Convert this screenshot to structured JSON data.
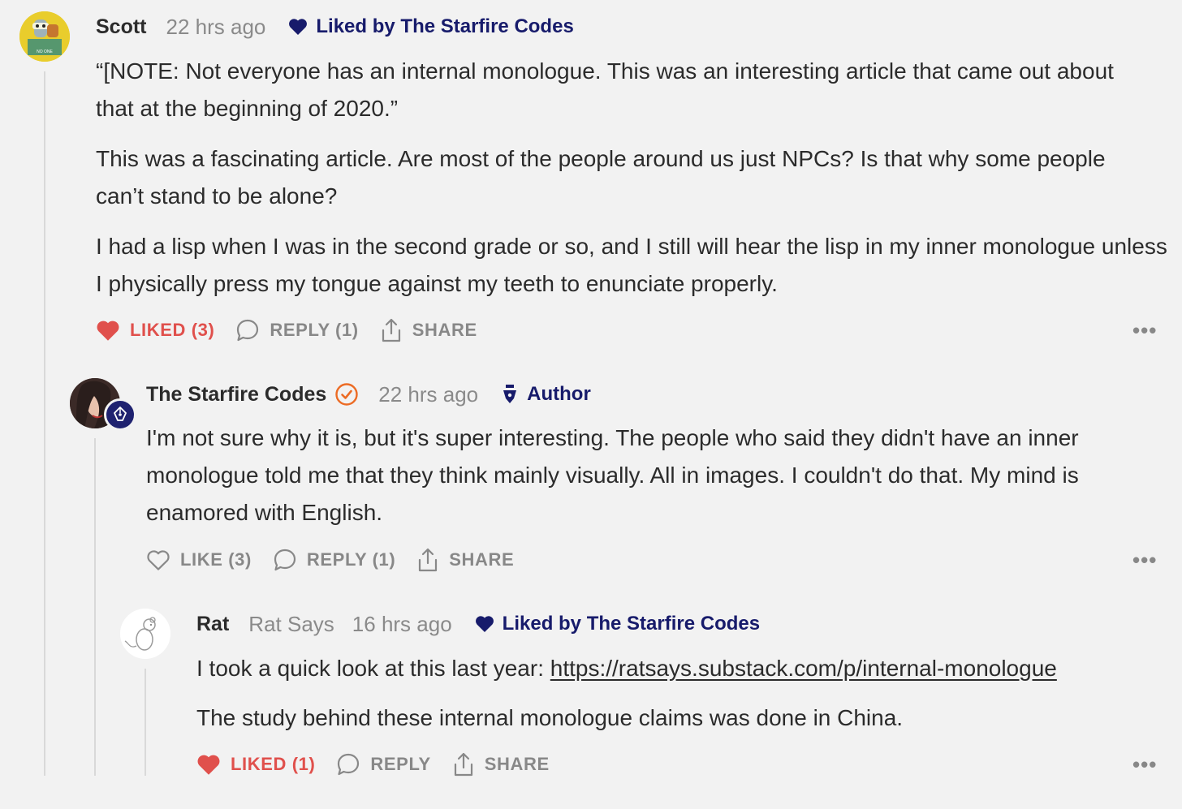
{
  "colors": {
    "background": "#f2f2f2",
    "text": "#2b2b2b",
    "muted": "#8a8a8a",
    "liked_red": "#e0504c",
    "navy": "#171b6b",
    "verified_orange": "#ec6b24"
  },
  "comments": [
    {
      "author": "Scott",
      "timestamp": "22 hrs ago",
      "badge_icon": "heart-icon",
      "badge_text": "Liked by The Starfire Codes",
      "paragraphs": [
        "“[NOTE: Not everyone has an internal monologue. This was an interesting article that came out about that at the beginning of 2020.”",
        "This was a fascinating article. Are most of the people around us just NPCs? Is that why some people can’t stand to be alone?",
        "I had a lisp when I was in the second grade or so, and I still will hear the lisp in my inner monologue unless I physically press my tongue against my teeth to enunciate properly."
      ],
      "actions": {
        "like": "LIKED (3)",
        "reply": "REPLY (1)",
        "share": "SHARE",
        "more": "•••"
      }
    },
    {
      "author": "The Starfire Codes",
      "timestamp": "22 hrs ago",
      "verified_icon": "verified-check-icon",
      "badge_icon": "pen-nib-icon",
      "badge_text": "Author",
      "paragraphs": [
        "I'm not sure why it is, but it's super interesting. The people who said they didn't have an inner monologue told me that they think mainly visually. All in images. I couldn't do that. My mind is enamored with English."
      ],
      "actions": {
        "like": "LIKE (3)",
        "reply": "REPLY (1)",
        "share": "SHARE",
        "more": "•••"
      }
    },
    {
      "author": "Rat",
      "handle": "Rat Says",
      "timestamp": "16 hrs ago",
      "badge_icon": "heart-icon",
      "badge_text": "Liked by The Starfire Codes",
      "paragraph1_prefix": "I took a quick look at this last year: ",
      "link": "https://ratsays.substack.com/p/internal-monologue",
      "paragraph2": "The study behind these internal monologue claims was done in China.",
      "actions": {
        "like": "LIKED (1)",
        "reply": "REPLY",
        "share": "SHARE",
        "more": "•••"
      }
    }
  ]
}
